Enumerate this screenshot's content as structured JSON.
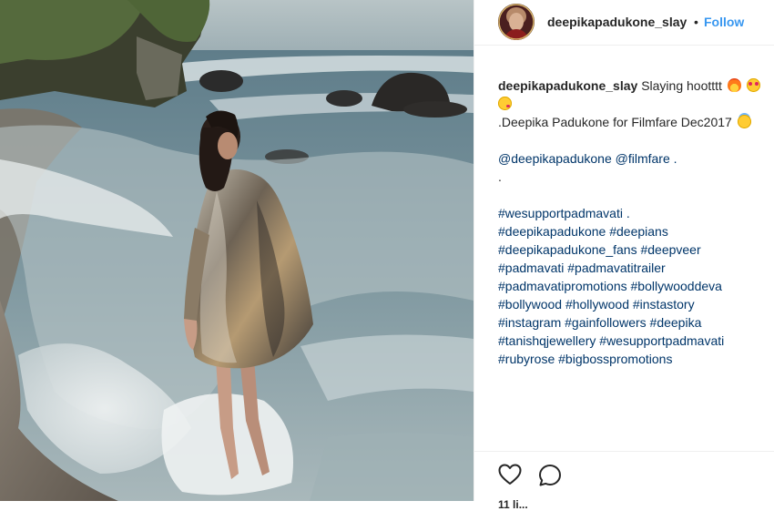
{
  "post": {
    "username": "deepikapadukone_slay",
    "separator": "•",
    "follow_label": "Follow"
  },
  "caption": {
    "username": "deepikapadukone_slay",
    "text": "Slaying hootttt",
    "emojis": [
      "fire-emoji",
      "heart-eyes-emoji",
      "kissing-emoji"
    ],
    "line2": ".Deepika Padukone for Filmfare Dec2017",
    "line2_emoji": "smiling-halo-emoji",
    "mentions": "@deepikapadukone @filmfare .",
    "dot": ".",
    "hashtag_lines": [
      "#wesupportpadmavati .",
      "#deepikapadukone #deepians",
      "#deepikapadukone_fans #deepveer",
      "#padmavati #padmavatitrailer",
      "#padmavatipromotions #bollywooddeva",
      "#bollywood #hollywood #instastory",
      "#instagram #gainfollowers #deepika",
      "#tanishqjewellery #wesupportpadmavati",
      "#rubyrose #bigbosspromotions"
    ]
  },
  "actions": {
    "like_icon": "heart-icon",
    "comment_icon": "comment-icon",
    "likes_text": "11 li..."
  },
  "colors": {
    "link": "#003569",
    "follow": "#3897f0",
    "text": "#262626"
  }
}
